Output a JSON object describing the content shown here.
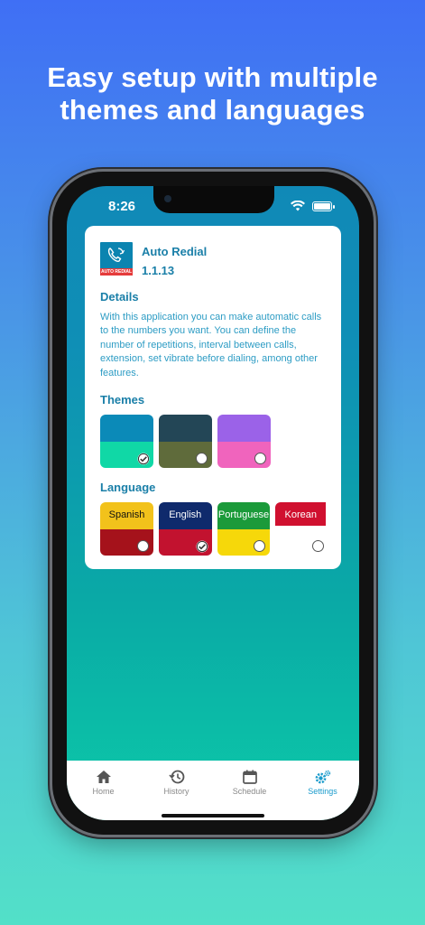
{
  "headline": {
    "line1": "Easy setup with multiple",
    "line2": "themes and languages"
  },
  "status_bar": {
    "time": "8:26"
  },
  "app": {
    "name": "Auto Redial",
    "version": "1.1.13",
    "icon_band_text": "AUTO REDIAL"
  },
  "details": {
    "title": "Details",
    "text": "With this application you can make automatic calls to the numbers you want. You can define the number of repetitions, interval between calls, extension, set vibrate before dialing, among other features."
  },
  "themes": {
    "title": "Themes",
    "items": [
      {
        "top": "#0b8ab8",
        "bottom": "#10d8a6",
        "selected": true
      },
      {
        "top": "#234656",
        "bottom": "#5f6b3b",
        "selected": false
      },
      {
        "top": "#9b62e8",
        "bottom": "#f064bd",
        "selected": false
      }
    ]
  },
  "language": {
    "title": "Language",
    "items": [
      {
        "label": "Spanish",
        "top": "#f2c21b",
        "bottom": "#a5121b",
        "text_color": "#111111",
        "selected": false
      },
      {
        "label": "English",
        "top": "#0f2a6c",
        "bottom": "#c2122f",
        "text_color": "#ffffff",
        "selected": true
      },
      {
        "label": "Portuguese",
        "top": "#1b9a3a",
        "bottom": "#f6d80a",
        "text_color": "#ffffff",
        "selected": false
      },
      {
        "label": "Korean",
        "top": "#d0102f",
        "bottom": "#ffffff",
        "text_color": "#ffffff",
        "selected": false
      }
    ]
  },
  "tabbar": {
    "items": [
      {
        "label": "Home",
        "icon": "home-icon",
        "active": false
      },
      {
        "label": "History",
        "icon": "history-icon",
        "active": false
      },
      {
        "label": "Schedule",
        "icon": "calendar-icon",
        "active": false
      },
      {
        "label": "Settings",
        "icon": "settings-icon",
        "active": true
      }
    ]
  },
  "colors": {
    "accent": "#1a7fa8",
    "tab_active": "#1a9bcc"
  }
}
